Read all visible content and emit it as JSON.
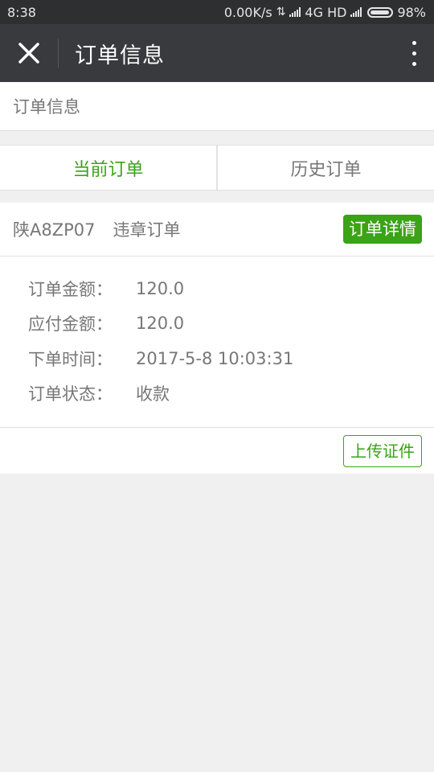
{
  "status_bar": {
    "time": "8:38",
    "network_speed": "0.00K/s",
    "network_type": "4G HD",
    "battery": "98%"
  },
  "nav": {
    "title": "订单信息",
    "close_icon": "close-icon",
    "more_icon": "more-vertical-icon"
  },
  "page": {
    "header": "订单信息"
  },
  "tabs": [
    {
      "label": "当前订单",
      "active": true
    },
    {
      "label": "历史订单",
      "active": false
    }
  ],
  "order": {
    "plate": "陕A8ZP07",
    "type": "违章订单",
    "detail_button": "订单详情",
    "fields": [
      {
        "label": "订单金额：",
        "value": "120.0"
      },
      {
        "label": "应付金额：",
        "value": "120.0"
      },
      {
        "label": "下单时间：",
        "value": "2017-5-8 10:03:31"
      },
      {
        "label": "订单状态：",
        "value": "收款"
      }
    ],
    "upload_button": "上传证件"
  },
  "colors": {
    "accent": "#3aa316",
    "nav_bg": "#393a3e",
    "status_bg": "#2e2f31",
    "page_bg": "#f0f0f0"
  }
}
